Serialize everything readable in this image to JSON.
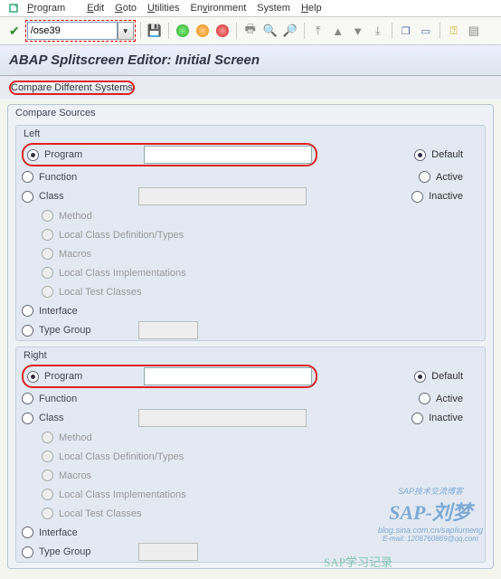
{
  "menu": {
    "program": "Program",
    "edit": "Edit",
    "goto": "Goto",
    "utilities": "Utilities",
    "environment": "Environment",
    "system": "System",
    "help": "Help"
  },
  "toolbar": {
    "input_value": "/ose39"
  },
  "title": "ABAP Splitscreen Editor: Initial Screen",
  "compare_btn": "Compare Different Systems",
  "sources_title": "Compare Sources",
  "left": {
    "title": "Left",
    "program": "Program",
    "function": "Function",
    "class": "Class",
    "method": "Method",
    "lcdt": "Local Class Definition/Types",
    "macros": "Macros",
    "lci": "Local Class Implementations",
    "ltc": "Local Test Classes",
    "interface": "Interface",
    "typegroup": "Type Group"
  },
  "right": {
    "title": "Right",
    "program": "Program",
    "function": "Function",
    "class": "Class",
    "method": "Method",
    "lcdt": "Local Class Definition/Types",
    "macros": "Macros",
    "lci": "Local Class Implementations",
    "ltc": "Local Test Classes",
    "interface": "Interface",
    "typegroup": "Type Group"
  },
  "opts": {
    "default": "Default",
    "active": "Active",
    "inactive": "Inactive"
  },
  "wm": {
    "name": "SAP-刘梦",
    "sub": "blog.sina.com.cn/sapliumeng",
    "top": "SAP技术交流博客",
    "side": "E-mail:  1206760869@qq.com",
    "bottom": "SAP学习记录"
  }
}
